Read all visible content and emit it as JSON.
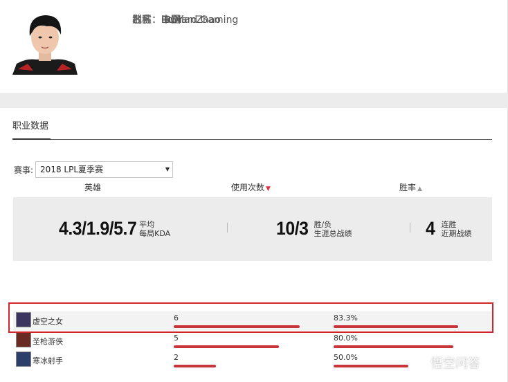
{
  "player": {
    "name_label": "名称：",
    "name": "iBOY",
    "alias_label": "别名：",
    "alias": "HuXianZhao",
    "region_label": "地区：",
    "region": "中国",
    "team_label": "战队：",
    "team": "Edward Gaming"
  },
  "career": {
    "tab_label": "职业数据",
    "season_label": "赛事:",
    "season_value": "2018 LPL夏季赛"
  },
  "stats": {
    "kda_value": "4.3/1.9/5.7",
    "kda_line1": "平均",
    "kda_line2": "每局KDA",
    "winloss_value": "10/3",
    "winloss_line1": "胜/负",
    "winloss_line2": "生涯总战绩",
    "streak_value": "4",
    "streak_line1": "连胜",
    "streak_line2": "近期战绩"
  },
  "table": {
    "col_hero": "英雄",
    "col_count": "使用次数",
    "col_winrate": "胜率",
    "rows": [
      {
        "hero": "虚空之女",
        "count": "6",
        "count_ratio": 1.0,
        "winrate": "83.3%",
        "winrate_ratio": 0.833,
        "icon_color": "#3b3560"
      },
      {
        "hero": "圣枪游侠",
        "count": "5",
        "count_ratio": 0.833,
        "winrate": "80.0%",
        "winrate_ratio": 0.8,
        "icon_color": "#6a2a24"
      },
      {
        "hero": "寒冰射手",
        "count": "2",
        "count_ratio": 0.333,
        "winrate": "50.0%",
        "winrate_ratio": 0.5,
        "icon_color": "#2c3f6b"
      }
    ]
  },
  "watermark": {
    "text": "悟空问答"
  },
  "colors": {
    "accent_red": "#c9343a",
    "highlight_border": "#d0262b"
  }
}
